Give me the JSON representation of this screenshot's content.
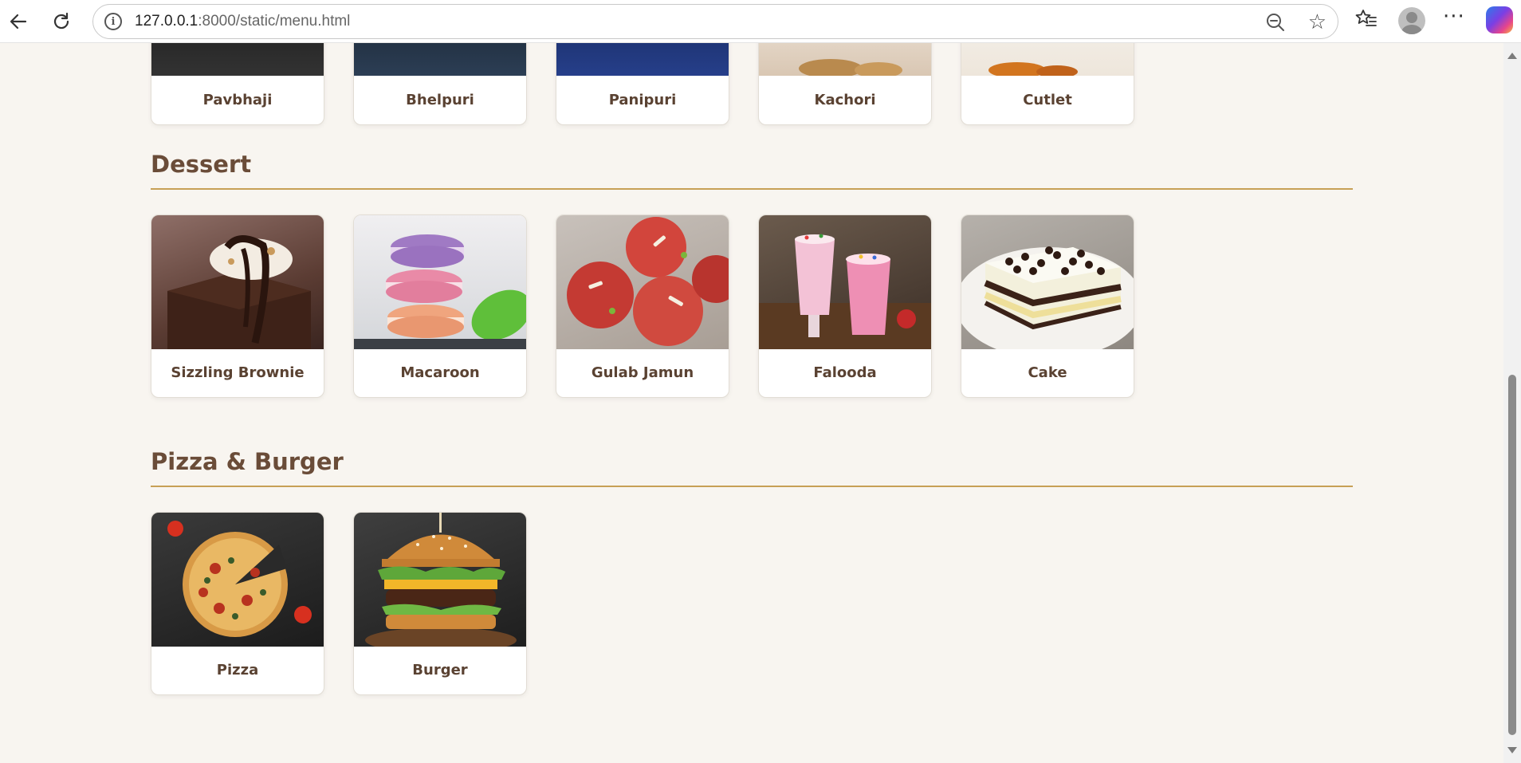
{
  "browser": {
    "url_host": "127.0.0.1",
    "url_rest": ":8000/static/menu.html"
  },
  "sections": {
    "top_row": {
      "items": [
        "Pavbhaji",
        "Bhelpuri",
        "Panipuri",
        "Kachori",
        "Cutlet"
      ]
    },
    "dessert": {
      "title": "Dessert",
      "items": [
        "Sizzling Brownie",
        "Macaroon",
        "Gulab Jamun",
        "Falooda",
        "Cake"
      ]
    },
    "pizza_burger": {
      "title": "Pizza & Burger",
      "items": [
        "Pizza",
        "Burger"
      ]
    }
  },
  "colors": {
    "heading": "#6a4c38",
    "rule": "#c7a056",
    "background": "#f8f5f0"
  }
}
